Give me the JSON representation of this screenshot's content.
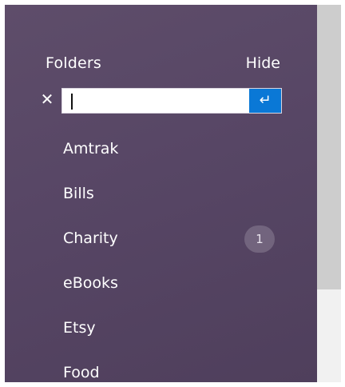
{
  "header": {
    "title": "Folders",
    "hide_label": "Hide"
  },
  "new_folder": {
    "cancel_icon": "close-icon",
    "input_value": "",
    "submit_icon": "enter-icon",
    "cancel_glyph": "✕",
    "submit_glyph": "↵"
  },
  "folders": [
    {
      "label": "Amtrak",
      "count": ""
    },
    {
      "label": "Bills",
      "count": ""
    },
    {
      "label": "Charity",
      "count": "1"
    },
    {
      "label": "eBooks",
      "count": ""
    },
    {
      "label": "Etsy",
      "count": ""
    },
    {
      "label": "Food",
      "count": ""
    }
  ],
  "colors": {
    "panel_bg": "#574665",
    "accent": "#0a78d6",
    "text": "#ffffff",
    "scrollbar_thumb": "#cdcdcd"
  }
}
